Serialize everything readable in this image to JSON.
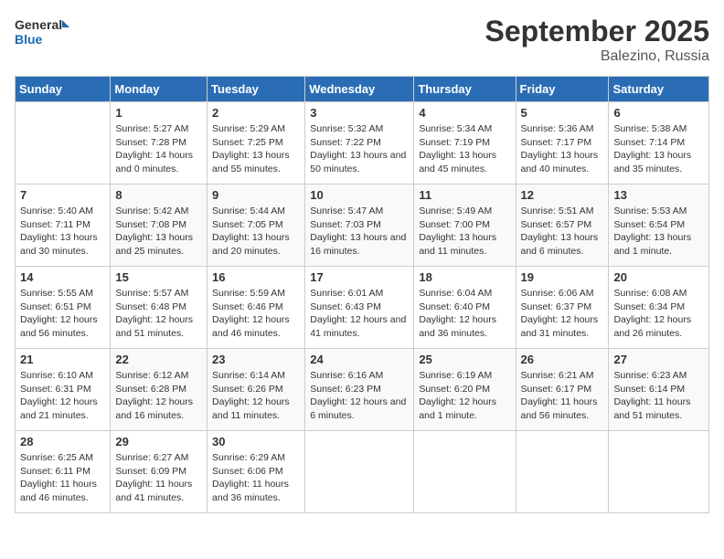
{
  "logo": {
    "general": "General",
    "blue": "Blue"
  },
  "title": "September 2025",
  "subtitle": "Balezino, Russia",
  "days_header": [
    "Sunday",
    "Monday",
    "Tuesday",
    "Wednesday",
    "Thursday",
    "Friday",
    "Saturday"
  ],
  "weeks": [
    [
      {
        "day": "",
        "sunrise": "",
        "sunset": "",
        "daylight": ""
      },
      {
        "day": "1",
        "sunrise": "Sunrise: 5:27 AM",
        "sunset": "Sunset: 7:28 PM",
        "daylight": "Daylight: 14 hours and 0 minutes."
      },
      {
        "day": "2",
        "sunrise": "Sunrise: 5:29 AM",
        "sunset": "Sunset: 7:25 PM",
        "daylight": "Daylight: 13 hours and 55 minutes."
      },
      {
        "day": "3",
        "sunrise": "Sunrise: 5:32 AM",
        "sunset": "Sunset: 7:22 PM",
        "daylight": "Daylight: 13 hours and 50 minutes."
      },
      {
        "day": "4",
        "sunrise": "Sunrise: 5:34 AM",
        "sunset": "Sunset: 7:19 PM",
        "daylight": "Daylight: 13 hours and 45 minutes."
      },
      {
        "day": "5",
        "sunrise": "Sunrise: 5:36 AM",
        "sunset": "Sunset: 7:17 PM",
        "daylight": "Daylight: 13 hours and 40 minutes."
      },
      {
        "day": "6",
        "sunrise": "Sunrise: 5:38 AM",
        "sunset": "Sunset: 7:14 PM",
        "daylight": "Daylight: 13 hours and 35 minutes."
      }
    ],
    [
      {
        "day": "7",
        "sunrise": "Sunrise: 5:40 AM",
        "sunset": "Sunset: 7:11 PM",
        "daylight": "Daylight: 13 hours and 30 minutes."
      },
      {
        "day": "8",
        "sunrise": "Sunrise: 5:42 AM",
        "sunset": "Sunset: 7:08 PM",
        "daylight": "Daylight: 13 hours and 25 minutes."
      },
      {
        "day": "9",
        "sunrise": "Sunrise: 5:44 AM",
        "sunset": "Sunset: 7:05 PM",
        "daylight": "Daylight: 13 hours and 20 minutes."
      },
      {
        "day": "10",
        "sunrise": "Sunrise: 5:47 AM",
        "sunset": "Sunset: 7:03 PM",
        "daylight": "Daylight: 13 hours and 16 minutes."
      },
      {
        "day": "11",
        "sunrise": "Sunrise: 5:49 AM",
        "sunset": "Sunset: 7:00 PM",
        "daylight": "Daylight: 13 hours and 11 minutes."
      },
      {
        "day": "12",
        "sunrise": "Sunrise: 5:51 AM",
        "sunset": "Sunset: 6:57 PM",
        "daylight": "Daylight: 13 hours and 6 minutes."
      },
      {
        "day": "13",
        "sunrise": "Sunrise: 5:53 AM",
        "sunset": "Sunset: 6:54 PM",
        "daylight": "Daylight: 13 hours and 1 minute."
      }
    ],
    [
      {
        "day": "14",
        "sunrise": "Sunrise: 5:55 AM",
        "sunset": "Sunset: 6:51 PM",
        "daylight": "Daylight: 12 hours and 56 minutes."
      },
      {
        "day": "15",
        "sunrise": "Sunrise: 5:57 AM",
        "sunset": "Sunset: 6:48 PM",
        "daylight": "Daylight: 12 hours and 51 minutes."
      },
      {
        "day": "16",
        "sunrise": "Sunrise: 5:59 AM",
        "sunset": "Sunset: 6:46 PM",
        "daylight": "Daylight: 12 hours and 46 minutes."
      },
      {
        "day": "17",
        "sunrise": "Sunrise: 6:01 AM",
        "sunset": "Sunset: 6:43 PM",
        "daylight": "Daylight: 12 hours and 41 minutes."
      },
      {
        "day": "18",
        "sunrise": "Sunrise: 6:04 AM",
        "sunset": "Sunset: 6:40 PM",
        "daylight": "Daylight: 12 hours and 36 minutes."
      },
      {
        "day": "19",
        "sunrise": "Sunrise: 6:06 AM",
        "sunset": "Sunset: 6:37 PM",
        "daylight": "Daylight: 12 hours and 31 minutes."
      },
      {
        "day": "20",
        "sunrise": "Sunrise: 6:08 AM",
        "sunset": "Sunset: 6:34 PM",
        "daylight": "Daylight: 12 hours and 26 minutes."
      }
    ],
    [
      {
        "day": "21",
        "sunrise": "Sunrise: 6:10 AM",
        "sunset": "Sunset: 6:31 PM",
        "daylight": "Daylight: 12 hours and 21 minutes."
      },
      {
        "day": "22",
        "sunrise": "Sunrise: 6:12 AM",
        "sunset": "Sunset: 6:28 PM",
        "daylight": "Daylight: 12 hours and 16 minutes."
      },
      {
        "day": "23",
        "sunrise": "Sunrise: 6:14 AM",
        "sunset": "Sunset: 6:26 PM",
        "daylight": "Daylight: 12 hours and 11 minutes."
      },
      {
        "day": "24",
        "sunrise": "Sunrise: 6:16 AM",
        "sunset": "Sunset: 6:23 PM",
        "daylight": "Daylight: 12 hours and 6 minutes."
      },
      {
        "day": "25",
        "sunrise": "Sunrise: 6:19 AM",
        "sunset": "Sunset: 6:20 PM",
        "daylight": "Daylight: 12 hours and 1 minute."
      },
      {
        "day": "26",
        "sunrise": "Sunrise: 6:21 AM",
        "sunset": "Sunset: 6:17 PM",
        "daylight": "Daylight: 11 hours and 56 minutes."
      },
      {
        "day": "27",
        "sunrise": "Sunrise: 6:23 AM",
        "sunset": "Sunset: 6:14 PM",
        "daylight": "Daylight: 11 hours and 51 minutes."
      }
    ],
    [
      {
        "day": "28",
        "sunrise": "Sunrise: 6:25 AM",
        "sunset": "Sunset: 6:11 PM",
        "daylight": "Daylight: 11 hours and 46 minutes."
      },
      {
        "day": "29",
        "sunrise": "Sunrise: 6:27 AM",
        "sunset": "Sunset: 6:09 PM",
        "daylight": "Daylight: 11 hours and 41 minutes."
      },
      {
        "day": "30",
        "sunrise": "Sunrise: 6:29 AM",
        "sunset": "Sunset: 6:06 PM",
        "daylight": "Daylight: 11 hours and 36 minutes."
      },
      {
        "day": "",
        "sunrise": "",
        "sunset": "",
        "daylight": ""
      },
      {
        "day": "",
        "sunrise": "",
        "sunset": "",
        "daylight": ""
      },
      {
        "day": "",
        "sunrise": "",
        "sunset": "",
        "daylight": ""
      },
      {
        "day": "",
        "sunrise": "",
        "sunset": "",
        "daylight": ""
      }
    ]
  ]
}
